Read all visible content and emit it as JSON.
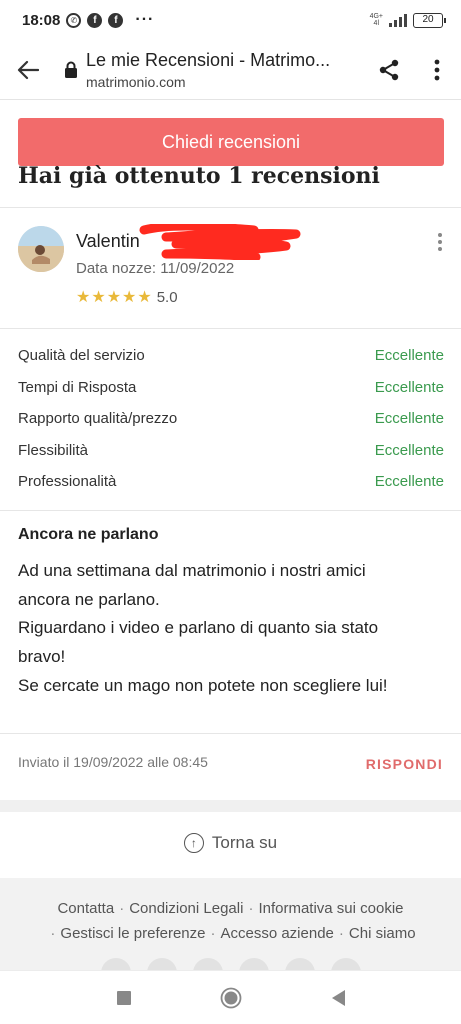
{
  "status_bar": {
    "time": "18:08",
    "network": "4G+",
    "battery": "20"
  },
  "browser": {
    "page_title": "Le mie Recensioni - Matrimo...",
    "domain": "matrimonio.com"
  },
  "cta_label": "Chiedi recensioni",
  "heading": "Hai già ottenuto 1 recensioni",
  "review": {
    "reviewer": "Valentin",
    "wedding_date": "Data nozze: 11/09/2022",
    "stars": 5,
    "rating": "5.0",
    "criteria": [
      {
        "label": "Qualità del servizio",
        "value": "Eccellente"
      },
      {
        "label": "Tempi di Risposta",
        "value": "Eccellente"
      },
      {
        "label": "Rapporto qualità/prezzo",
        "value": "Eccellente"
      },
      {
        "label": "Flessibilità",
        "value": "Eccellente"
      },
      {
        "label": "Professionalità",
        "value": "Eccellente"
      }
    ],
    "title": "Ancora ne parlano",
    "body": [
      "Ad una settimana dal matrimonio i nostri amici",
      "ancora ne parlano.",
      "Riguardano i video e parlano di quanto sia stato",
      "bravo!",
      "Se cercate un mago non potete non scegliere lui!"
    ],
    "sent": "Inviato il 19/09/2022 alle 08:45",
    "reply_label": "RISPONDI"
  },
  "back_to_top": "Torna su",
  "footer": {
    "links_row1": [
      "Contatta",
      "Condizioni Legali",
      "Informativa sui cookie"
    ],
    "links_row2": [
      "Gestisci le preferenze",
      "Accesso aziende",
      "Chi siamo"
    ]
  },
  "colors": {
    "accent": "#f26b6b",
    "reply": "#e06b6b",
    "excellent": "#3a9a4e",
    "stars": "#e9b93a"
  }
}
